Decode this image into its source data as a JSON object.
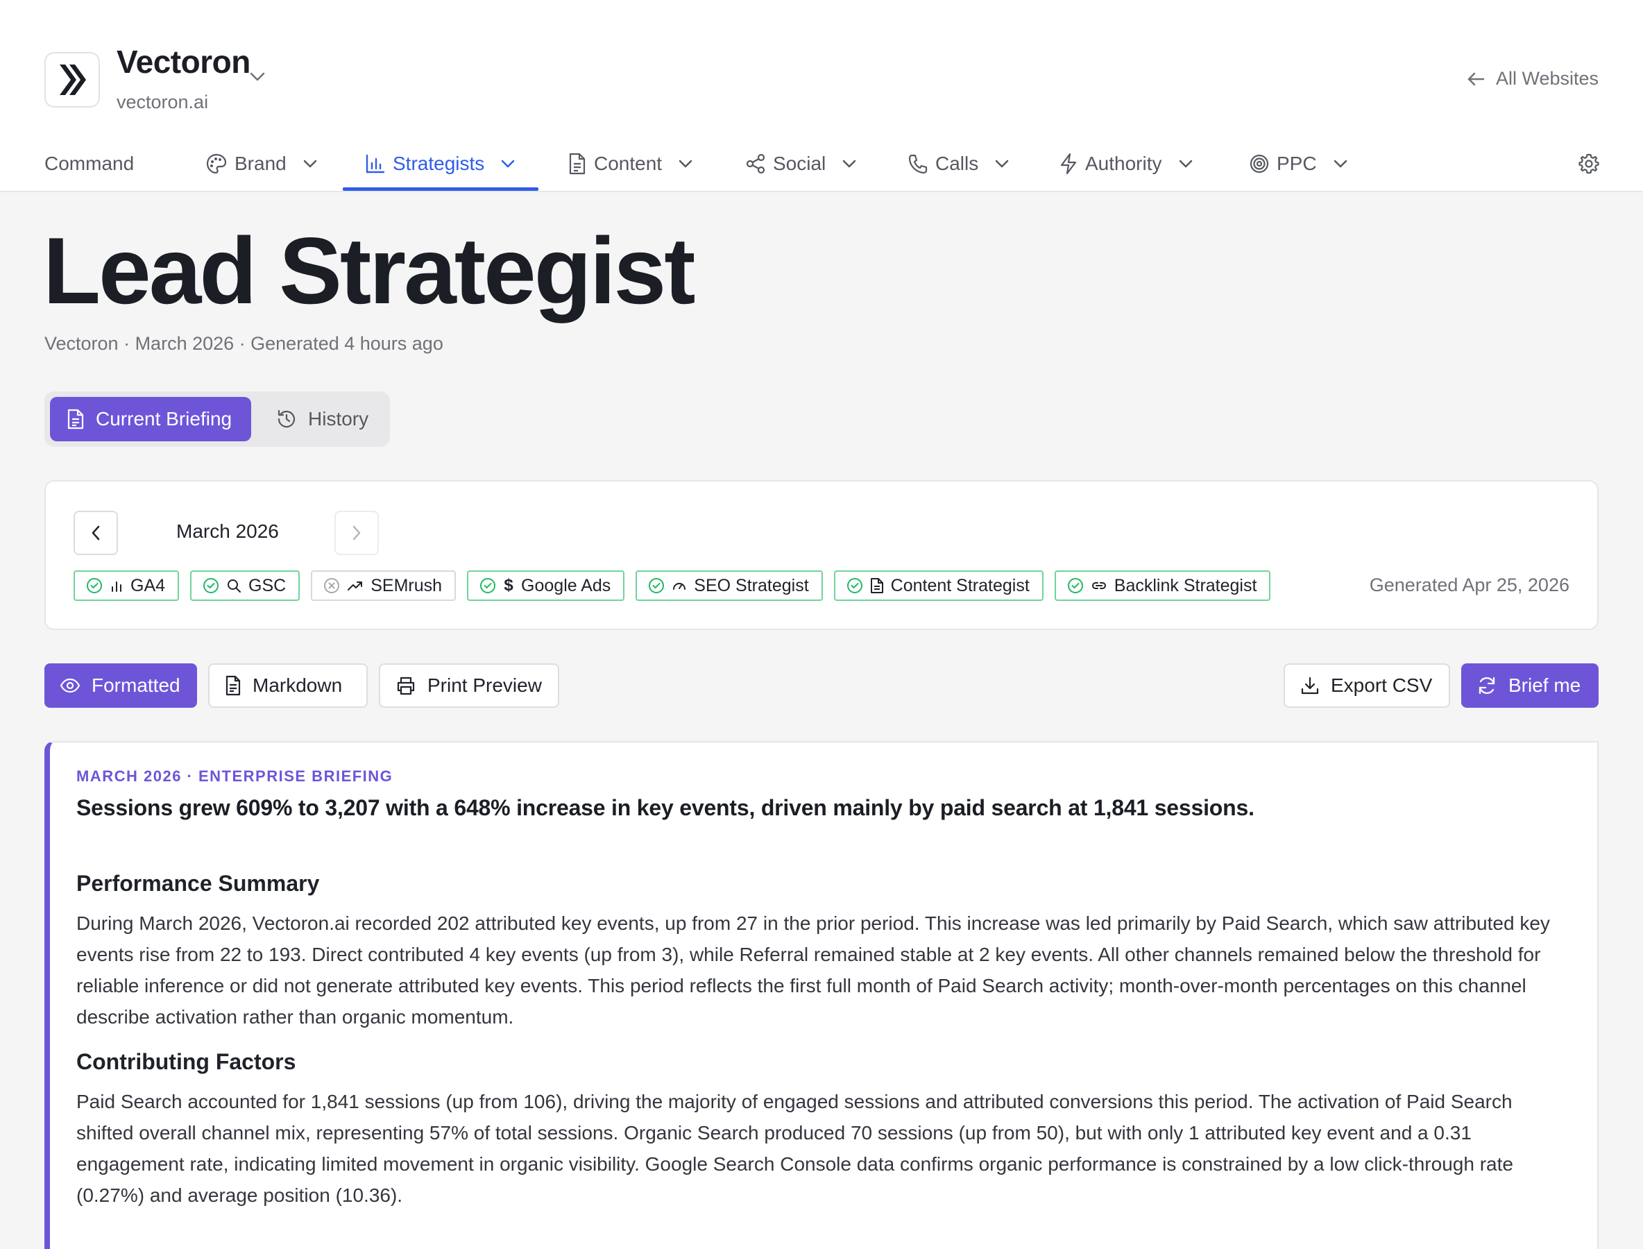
{
  "site": {
    "name": "Vectoron",
    "domain": "vectoron.ai",
    "all_websites_label": "All Websites"
  },
  "nav": {
    "items": [
      {
        "label": "Command"
      },
      {
        "label": "Brand"
      },
      {
        "label": "Strategists"
      },
      {
        "label": "Content"
      },
      {
        "label": "Social"
      },
      {
        "label": "Calls"
      },
      {
        "label": "Authority"
      },
      {
        "label": "PPC"
      }
    ],
    "active": "Strategists"
  },
  "page": {
    "title": "Lead Strategist",
    "subtitle": "Vectoron · March 2026 · Generated 4 hours ago"
  },
  "view_toggle": {
    "current": "Current Briefing",
    "history": "History"
  },
  "period_card": {
    "month": "March 2026",
    "generated": "Generated Apr 25, 2026",
    "sources": [
      {
        "label": "GA4",
        "status": "ok",
        "icon": "bar-chart-icon"
      },
      {
        "label": "GSC",
        "status": "ok",
        "icon": "search-icon"
      },
      {
        "label": "SEMrush",
        "status": "unavailable",
        "icon": "trend-up-icon"
      },
      {
        "label": "Google Ads",
        "status": "ok",
        "icon": "dollar-icon"
      },
      {
        "label": "SEO Strategist",
        "status": "ok",
        "icon": "gauge-icon"
      },
      {
        "label": "Content Strategist",
        "status": "ok",
        "icon": "document-icon"
      },
      {
        "label": "Backlink Strategist",
        "status": "ok",
        "icon": "link-icon"
      }
    ]
  },
  "actions": {
    "formatted": "Formatted",
    "markdown": "Markdown",
    "print_preview": "Print Preview",
    "export_csv": "Export CSV",
    "brief_me": "Brief me"
  },
  "briefing": {
    "eyebrow": "MARCH 2026 · ENTERPRISE BRIEFING",
    "headline": "Sessions grew 609% to 3,207 with a 648% increase in key events, driven mainly by paid search at 1,841 sessions.",
    "sections": [
      {
        "title": "Performance Summary",
        "body": "During March 2026, Vectoron.ai recorded 202 attributed key events, up from 27 in the prior period. This increase was led primarily by Paid Search, which saw attributed key events rise from 22 to 193. Direct contributed 4 key events (up from 3), while Referral remained stable at 2 key events. All other channels remained below the threshold for reliable inference or did not generate attributed key events. This period reflects the first full month of Paid Search activity; month-over-month percentages on this channel describe activation rather than organic momentum."
      },
      {
        "title": "Contributing Factors",
        "body": "Paid Search accounted for 1,841 sessions (up from 106), driving the majority of engaged sessions and attributed conversions this period. The activation of Paid Search shifted overall channel mix, representing 57% of total sessions. Organic Search produced 70 sessions (up from 50), but with only 1 attributed key event and a 0.31 engagement rate, indicating limited movement in organic visibility. Google Search Console data confirms organic performance is constrained by a low click-through rate (0.27%) and average position (10.36)."
      }
    ]
  },
  "colors": {
    "accent": "#6e55d8",
    "nav_active": "#2f5de8",
    "source_ok": "#22b864",
    "text_muted": "#6f7178"
  }
}
